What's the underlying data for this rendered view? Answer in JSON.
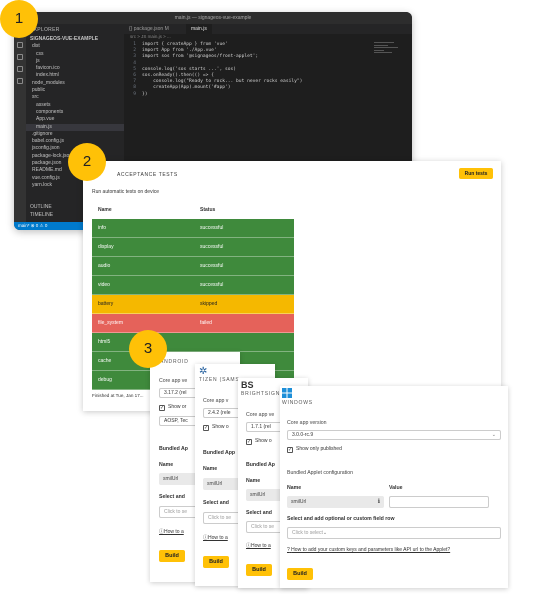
{
  "badges": [
    "1",
    "2",
    "3"
  ],
  "vscode": {
    "window_title": "main.js — signageos-vue-example",
    "explorer_header": "EXPLORER",
    "project": "SIGNAGEOS-VUE-EXAMPLE",
    "files": [
      "dist",
      "css",
      "js",
      "favicon.ico",
      "index.html",
      "node_modules",
      "public",
      "src",
      "assets",
      "components",
      "App.vue",
      "main.js",
      ".gitignore",
      "babel.config.js",
      "jsconfig.json",
      "package-lock.json",
      "package.json",
      "README.md",
      "vue.config.js",
      "yarn.lock"
    ],
    "outline": "OUTLINE",
    "timeline": "TIMELINE",
    "tabs": [
      "{} package.json M",
      "main.js"
    ],
    "breadcrumb": "src > JS main.js > ...",
    "code": [
      "import { createApp } from 'vue'",
      "import App from './App.vue'",
      "import sos from '@signageos/front-applet';",
      "",
      "console.log('sos starts ...', sos)",
      "sos.onReady().then(() => {",
      "    console.log(\"Ready to rock... but never rocks easily\")",
      "    createApp(App).mount('#app')",
      "})"
    ],
    "status": "main*  ⊗ 0 ⚠ 0"
  },
  "acceptance": {
    "title": "ACCEPTANCE TESTS",
    "run_label": "Run tests",
    "subtitle": "Run automatic tests on device",
    "col_name": "Name",
    "col_status": "Status",
    "rows": [
      {
        "name": "info",
        "status": "successful"
      },
      {
        "name": "display",
        "status": "successful"
      },
      {
        "name": "audio",
        "status": "successful"
      },
      {
        "name": "video",
        "status": "successful"
      },
      {
        "name": "battery",
        "status": "skipped"
      },
      {
        "name": "file_system",
        "status": "failed"
      },
      {
        "name": "html5",
        "status": ""
      },
      {
        "name": "cache",
        "status": ""
      },
      {
        "name": "debug",
        "status": ""
      }
    ],
    "finished": "Finished at Tue, Jan 17..."
  },
  "colors": {
    "successful": "#3f8a3c",
    "skipped": "#f5b800",
    "failed": "#e5625a",
    "accent": "#ffc107"
  },
  "cards": {
    "android": {
      "platform": "ANDROID",
      "core_label": "Core app ve",
      "core_value": "3.17.2 (rel",
      "show_only": "Show or",
      "os_value": "AOSP, Tec",
      "bundled": "Bundled Ap",
      "name_label": "Name",
      "name_value": "smilUrl",
      "select_label": "Select and",
      "select_hint": "Click to se",
      "howto": "How to a",
      "build": "Build"
    },
    "tizen": {
      "platform": "TIZEN (SAMS",
      "core_label": "Core app v",
      "core_value": "2.4.2 (rele",
      "show_only": "Show o",
      "bundled": "Bundled App",
      "name_label": "Name",
      "name_value": "smilUrl",
      "select_label": "Select and",
      "select_hint": "Click to se",
      "howto": "How to a",
      "build": "Build"
    },
    "brightsign": {
      "platform": "BRIGHTSIGN",
      "logo": "BS",
      "core_label": "Core app ve",
      "core_value": "1.7.1 (rel",
      "show_only": "Show o",
      "bundled": "Bundled Ap",
      "name_label": "Name",
      "name_value": "smilUrl",
      "select_label": "Select and",
      "select_hint": "Click to se",
      "howto": "How to a",
      "build": "Build"
    },
    "windows": {
      "platform": "WINDOWS",
      "core_label": "Core app version",
      "core_value": "3.0.0-rc.9",
      "show_only": "Show only published",
      "bundled": "Bundled Applet configuration",
      "name_label": "Name",
      "value_label": "Value",
      "name_value": "smilUrl",
      "select_label": "Select and add optional or custom field row",
      "select_hint": "Click to select",
      "howto": "How to add your custom keys and parameters like API url to the Applet?",
      "build": "Build"
    }
  }
}
